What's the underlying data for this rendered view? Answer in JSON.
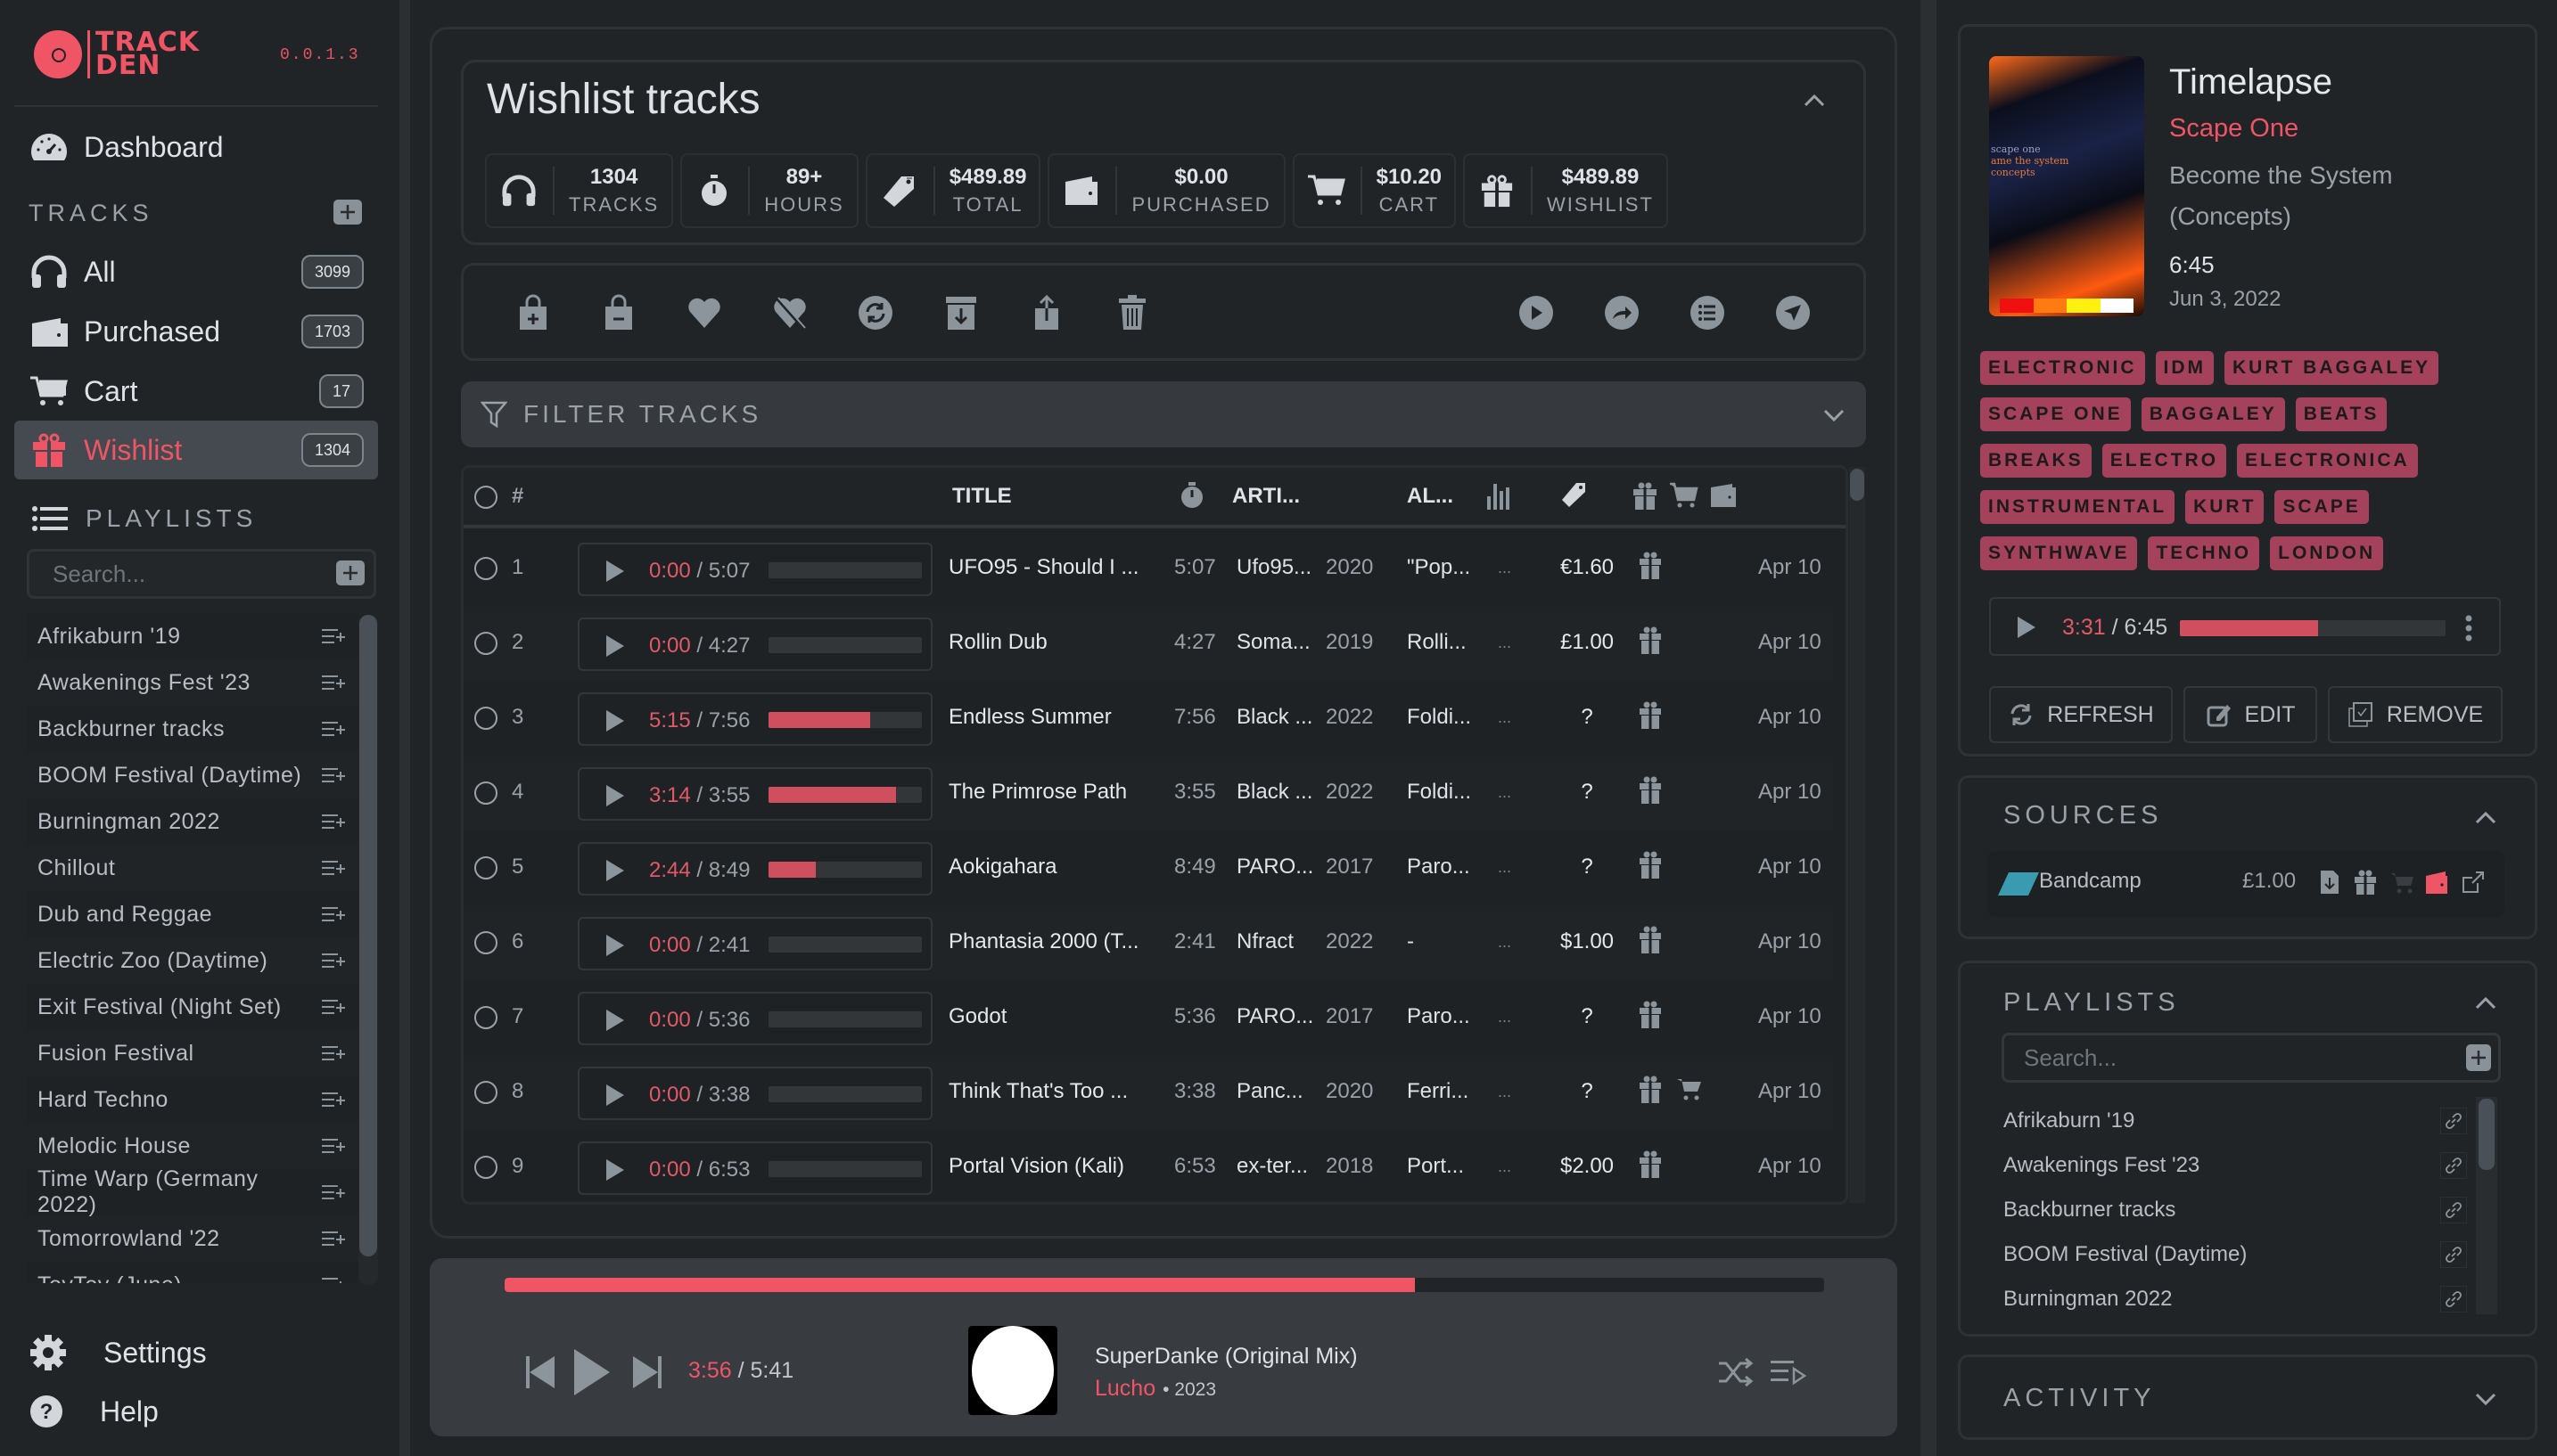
{
  "app": {
    "name_line1": "TRACK",
    "name_line2": "DEN",
    "version": "0.0.1.3",
    "accent": "#f05566"
  },
  "sidebar": {
    "dashboard": "Dashboard",
    "tracks_heading": "TRACKS",
    "tracks": [
      {
        "label": "All",
        "count": "3099",
        "icon": "headphones-icon"
      },
      {
        "label": "Purchased",
        "count": "1703",
        "icon": "wallet-icon"
      },
      {
        "label": "Cart",
        "count": "17",
        "icon": "cart-icon"
      },
      {
        "label": "Wishlist",
        "count": "1304",
        "icon": "gift-icon",
        "active": true
      }
    ],
    "playlists_heading": "PLAYLISTS",
    "search_placeholder": "Search...",
    "playlists": [
      "Afrikaburn '19",
      "Awakenings Fest '23",
      "Backburner tracks",
      "BOOM Festival (Daytime)",
      "Burningman 2022",
      "Chillout",
      "Dub and Reggae",
      "Electric Zoo (Daytime)",
      "Exit Festival (Night Set)",
      "Fusion Festival",
      "Hard Techno",
      "Melodic House",
      "Time Warp (Germany 2022)",
      "Tomorrowland '22",
      "ToyToy (June)"
    ],
    "settings": "Settings",
    "help": "Help"
  },
  "main": {
    "title": "Wishlist tracks",
    "stats": [
      {
        "value": "1304",
        "caption": "TRACKS",
        "icon": "headphones-icon"
      },
      {
        "value": "89+",
        "caption": "HOURS",
        "icon": "stopwatch-icon"
      },
      {
        "value": "$489.89",
        "caption": "TOTAL",
        "icon": "tags-icon"
      },
      {
        "value": "$0.00",
        "caption": "PURCHASED",
        "icon": "wallet-icon"
      },
      {
        "value": "$10.20",
        "caption": "CART",
        "icon": "cart-icon"
      },
      {
        "value": "$489.89",
        "caption": "WISHLIST",
        "icon": "gift-icon"
      }
    ],
    "filter_label": "FILTER TRACKS",
    "columns": {
      "num": "#",
      "title": "TITLE",
      "artist": "ARTI...",
      "album": "AL..."
    },
    "rows": [
      {
        "n": "1",
        "cur": "0:00",
        "dur": "5:07",
        "progress": 0,
        "title": "UFO95 - Should I ...",
        "length": "5:07",
        "artist": "Ufo95...",
        "year": "2020",
        "album": "\"Pop...",
        "more": "...",
        "price": "€1.60",
        "cart": false,
        "date": "Apr 10"
      },
      {
        "n": "2",
        "cur": "0:00",
        "dur": "4:27",
        "progress": 0,
        "title": "Rollin Dub",
        "length": "4:27",
        "artist": "Soma...",
        "year": "2019",
        "album": "Rolli...",
        "more": "...",
        "price": "£1.00",
        "cart": false,
        "date": "Apr 10"
      },
      {
        "n": "3",
        "cur": "5:15",
        "dur": "7:56",
        "progress": 0.66,
        "title": "Endless Summer",
        "length": "7:56",
        "artist": "Black ...",
        "year": "2022",
        "album": "Foldi...",
        "more": "...",
        "price": "?",
        "cart": false,
        "date": "Apr 10"
      },
      {
        "n": "4",
        "cur": "3:14",
        "dur": "3:55",
        "progress": 0.83,
        "title": "The Primrose Path",
        "length": "3:55",
        "artist": "Black ...",
        "year": "2022",
        "album": "Foldi...",
        "more": "...",
        "price": "?",
        "cart": false,
        "date": "Apr 10"
      },
      {
        "n": "5",
        "cur": "2:44",
        "dur": "8:49",
        "progress": 0.31,
        "title": "Aokigahara",
        "length": "8:49",
        "artist": "PARO...",
        "year": "2017",
        "album": "Paro...",
        "more": "...",
        "price": "?",
        "cart": false,
        "date": "Apr 10"
      },
      {
        "n": "6",
        "cur": "0:00",
        "dur": "2:41",
        "progress": 0,
        "title": "Phantasia 2000 (T...",
        "length": "2:41",
        "artist": "Nfract",
        "year": "2022",
        "album": "-",
        "more": "...",
        "price": "$1.00",
        "cart": false,
        "date": "Apr 10"
      },
      {
        "n": "7",
        "cur": "0:00",
        "dur": "5:36",
        "progress": 0,
        "title": "Godot",
        "length": "5:36",
        "artist": "PARO...",
        "year": "2017",
        "album": "Paro...",
        "more": "...",
        "price": "?",
        "cart": false,
        "date": "Apr 10"
      },
      {
        "n": "8",
        "cur": "0:00",
        "dur": "3:38",
        "progress": 0,
        "title": "Think That's Too ...",
        "length": "3:38",
        "artist": "Panc...",
        "year": "2020",
        "album": "Ferri...",
        "more": "...",
        "price": "?",
        "cart": true,
        "date": "Apr 10"
      },
      {
        "n": "9",
        "cur": "0:00",
        "dur": "6:53",
        "progress": 0,
        "title": "Portal Vision (Kali)",
        "length": "6:53",
        "artist": "ex-ter...",
        "year": "2018",
        "album": "Port...",
        "more": "...",
        "price": "$2.00",
        "cart": false,
        "date": "Apr 10"
      }
    ]
  },
  "player": {
    "current": "3:56",
    "duration": "5:41",
    "progress": 0.69,
    "title": "SuperDanke (Original Mix)",
    "artist": "Lucho",
    "year": "• 2023"
  },
  "details": {
    "title": "Timelapse",
    "artist": "Scape One",
    "album": "Become the System (Concepts)",
    "duration": "6:45",
    "date": "Jun 3, 2022",
    "cover_text": [
      "scape one",
      "ame the system",
      "concepts"
    ],
    "tags": [
      "ELECTRONIC",
      "IDM",
      "KURT BAGGALEY",
      "SCAPE ONE",
      "BAGGALEY",
      "BEATS",
      "BREAKS",
      "ELECTRO",
      "ELECTRONICA",
      "INSTRUMENTAL",
      "KURT",
      "SCAPE",
      "SYNTHWAVE",
      "TECHNO",
      "LONDON"
    ],
    "preview": {
      "current": "3:31",
      "duration": "6:45",
      "progress": 0.52
    },
    "buttons": {
      "refresh": "REFRESH",
      "edit": "EDIT",
      "remove": "REMOVE"
    }
  },
  "sources": {
    "heading": "SOURCES",
    "items": [
      {
        "name": "Bandcamp",
        "price": "£1.00"
      }
    ]
  },
  "rplaylists": {
    "heading": "PLAYLISTS",
    "search_placeholder": "Search...",
    "items": [
      "Afrikaburn '19",
      "Awakenings Fest '23",
      "Backburner tracks",
      "BOOM Festival (Daytime)",
      "Burningman 2022"
    ]
  },
  "activity": {
    "heading": "ACTIVITY"
  }
}
